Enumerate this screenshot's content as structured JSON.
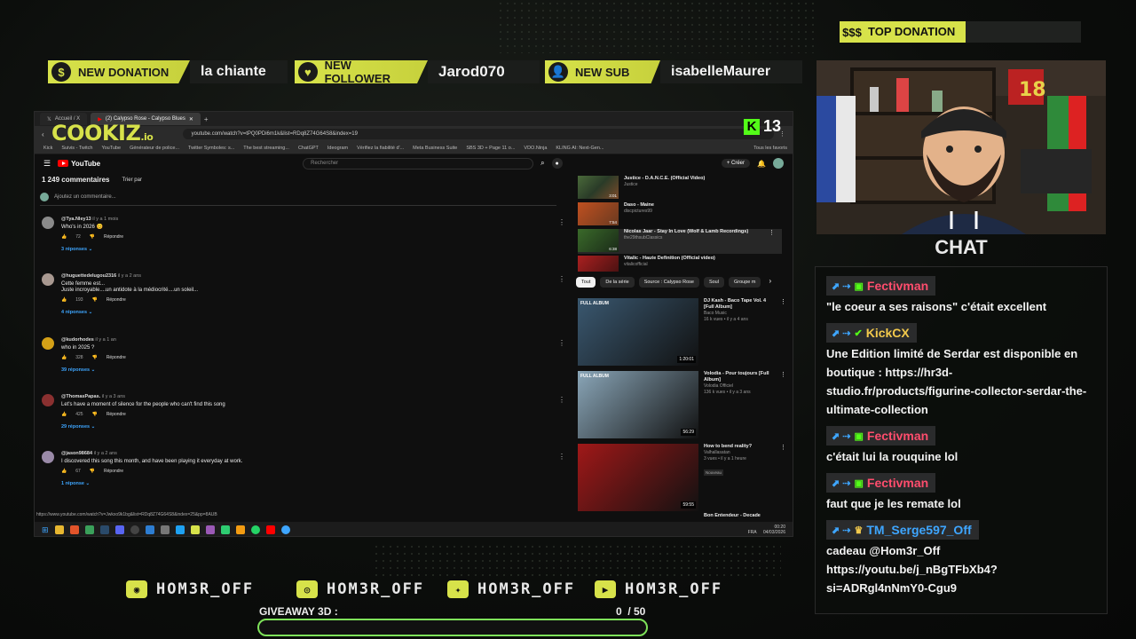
{
  "top_donation": {
    "badge": "$$$",
    "label": "TOP DONATION"
  },
  "alerts": [
    {
      "icon": "$",
      "label": "NEW DONATION",
      "value": "la chiante"
    },
    {
      "icon": "♥",
      "label": "NEW FOLLOWER",
      "value": "Jarod070"
    },
    {
      "icon": "👤",
      "label": "NEW SUB",
      "value": "isabelleMaurer"
    }
  ],
  "overlay_logo": {
    "main": "COOKIZ",
    "suffix": ".io"
  },
  "kick_counter": {
    "icon": "K",
    "value": "13"
  },
  "browser": {
    "tabs": [
      "Accueil / X",
      "(2) Calypso Rose - Calypso Blues"
    ],
    "url": "youtube.com/watch?v=tPQ0PDi6m1k&list=RDq8Z74G64S8&index=19",
    "bookmarks": [
      "Kick",
      "Suivis - Twitch",
      "YouTube",
      "Générateur de police...",
      "Twitter Symboles: s...",
      "The best streaming...",
      "ChatGPT",
      "Ideogram",
      "Vérifiez la fiabilité d'...",
      "Meta Business Suite",
      "SBS 3D + Page 11 o...",
      "VDO.Ninja",
      "KLING AI: Next-Gen...",
      "Tous les favoris"
    ],
    "youtube": {
      "logo": "YouTube",
      "search_placeholder": "Rechercher",
      "create_label": "+ Créer",
      "comments_header": "1 249 commentaires",
      "sort_label": "Trier par",
      "add_comment_placeholder": "Ajoutez un commentaire...",
      "comments": [
        {
          "author": "@Tya.Nley13",
          "time": "il y a 1 mois",
          "text": "Who's in 2026 😊",
          "likes": "72",
          "reply_label": "Répondre",
          "replies": "3 réponses"
        },
        {
          "author": "@huguettedelugou2316",
          "time": "il y a 2 ans",
          "text": "Cette femme est...\nJuste incroyable....un antidote à la médiocrité....un soleil...",
          "likes": "193",
          "reply_label": "Répondre",
          "replies": "4 réponses"
        },
        {
          "author": "@kudorhodes",
          "time": "il y a 1 an",
          "text": "who in 2025 ?",
          "likes": "328",
          "reply_label": "Répondre",
          "replies": "39 réponses"
        },
        {
          "author": "@ThomasPapas.",
          "time": "il y a 3 ans",
          "text": "Let's have a moment of silence for the people who can't find this song",
          "likes": "425",
          "reply_label": "Répondre",
          "replies": "29 réponses"
        },
        {
          "author": "@jason98684",
          "time": "il y a 2 ans",
          "text": "I discovered this song this month, and have been playing it everyday at work.",
          "likes": "67",
          "reply_label": "Répondre",
          "replies": "1 réponse"
        }
      ],
      "playlist": [
        {
          "title": "Justice - D.A.N.C.E. (Official Video)",
          "channel": "Justice",
          "duration": "3:01"
        },
        {
          "title": "Daso - Maine",
          "channel": "discpictures99",
          "duration": "7:54"
        },
        {
          "title": "Nicolas Jaar - Stay In Love (Wolf & Lamb Recordings)",
          "channel": "the29thsubClassics",
          "duration": "6:38"
        },
        {
          "title": "Vitalic - Haute Definition (Official video)",
          "channel": "vitalicofficial",
          "duration": ""
        }
      ],
      "chips": [
        "Tout",
        "De la série",
        "Source : Calypso Rose",
        "Soul",
        "Groupe m"
      ],
      "recommendations": [
        {
          "title": "DJ Kash - Baco Tape Vol. 4 [Full Album]",
          "channel": "Baco Music",
          "stats": "16 k vues • il y a 4 ans",
          "duration": "1:20:01",
          "badge": "FULL ALBUM",
          "new_label": "",
          "thumb_color": "#3a5870"
        },
        {
          "title": "Volodia - Pour toujours [Full Album]",
          "channel": "Volodia Officiel",
          "stats": "136 k vues • il y a 3 ans",
          "duration": "56:29",
          "badge": "FULL ALBUM",
          "new_label": "",
          "thumb_color": "#8aa6b8"
        },
        {
          "title": "How to bend reality?",
          "channel": "Valhallasatan",
          "stats": "3 vues • il y a 1 heure",
          "duration": "59:55",
          "badge": "",
          "new_label": "Nouveau",
          "thumb_color": "#a01818"
        }
      ],
      "next_title": "Bon Entendeur - Decade",
      "status_url": "https://www.youtube.com/watch?v=Jwkxo9k1bg&list=RDq8Z74G64S8&index=25&pp=8AUB"
    },
    "taskbar_clock": {
      "time": "00:20",
      "date": "04/03/2026",
      "lang": "FRA"
    }
  },
  "chat": {
    "title": "CHAT",
    "messages": [
      {
        "user": "Fectivman",
        "color": "#ff4d6d",
        "text": "\"le coeur a ses raisons\" c'était excellent"
      },
      {
        "user": "KickCX",
        "color": "#f2c94c",
        "text": "Une Edition limité de Serdar est disponible en boutique : https://hr3d-studio.fr/products/figurine-collector-serdar-the-ultimate-collection"
      },
      {
        "user": "Fectivman",
        "color": "#ff4d6d",
        "text": "c'était lui la rouquine lol"
      },
      {
        "user": "Fectivman",
        "color": "#ff4d6d",
        "text": "faut que je les remate lol"
      },
      {
        "user": "TM_Serge597_Off",
        "color": "#3ea6ff",
        "text": "cadeau @Hom3r_Off https://youtu.be/j_nBgTFbXb4?si=ADRgl4nNmY0-Cgu9"
      }
    ]
  },
  "socials": [
    {
      "icon": "discord-icon",
      "glyph": "◉",
      "handle": "HOM3R_OFF"
    },
    {
      "icon": "instagram-icon",
      "glyph": "◎",
      "handle": "HOM3R_OFF"
    },
    {
      "icon": "twitter-icon",
      "glyph": "✦",
      "handle": "HOM3R_OFF"
    },
    {
      "icon": "youtube-icon",
      "glyph": "▶",
      "handle": "HOM3R_OFF"
    }
  ],
  "giveaway": {
    "label": "GIVEAWAY 3D :",
    "count": "0  / 50",
    "progress": 0
  },
  "colors": {
    "accent": "#d7e24a",
    "kick_green": "#53fc18",
    "progress_border": "#7ee25a"
  }
}
